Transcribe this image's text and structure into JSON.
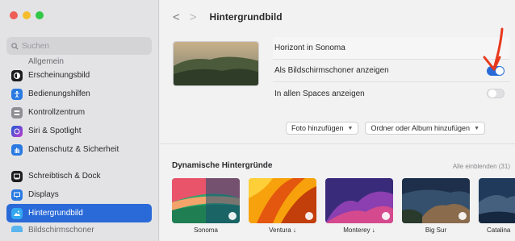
{
  "window": {
    "traffic_colors": [
      "#ee5e57",
      "#f5bd2e",
      "#33c748"
    ]
  },
  "sidebar": {
    "search_placeholder": "Suchen",
    "partial_top": "Allgemein",
    "items": [
      {
        "label": "Erscheinungsbild",
        "icon": "appearance-icon",
        "color": "#1d1d1f"
      },
      {
        "label": "Bedienungshilfen",
        "icon": "accessibility-icon",
        "color": "#2a7ae2"
      },
      {
        "label": "Kontrollzentrum",
        "icon": "control-center-icon",
        "color": "#8e8e93"
      },
      {
        "label": "Siri & Spotlight",
        "icon": "siri-icon",
        "color": "#7b4dd8"
      },
      {
        "label": "Datenschutz & Sicherheit",
        "icon": "privacy-hand-icon",
        "color": "#2a7ae2"
      },
      {
        "label": "Schreibtisch & Dock",
        "icon": "dock-icon",
        "color": "#1d1d1f"
      },
      {
        "label": "Displays",
        "icon": "displays-icon",
        "color": "#2a7ae2"
      },
      {
        "label": "Hintergrundbild",
        "icon": "wallpaper-icon",
        "color": "#33a7f0"
      },
      {
        "label": "Bildschirmschoner",
        "icon": "screensaver-icon",
        "color": "#5ab5ef"
      }
    ],
    "selected_index": 7
  },
  "header": {
    "back": "<",
    "forward": ">",
    "title": "Hintergrundbild"
  },
  "wallpaper": {
    "name": "Horizont in Sonoma",
    "screensaver_label": "Als Bildschirmschoner anzeigen",
    "screensaver_on": true,
    "spaces_label": "In allen Spaces anzeigen",
    "spaces_on": false
  },
  "actions": {
    "add_photo": "Foto hinzufügen",
    "add_folder": "Ordner oder Album hinzufügen"
  },
  "dynamic": {
    "heading": "Dynamische Hintergründe",
    "show_all": "Alle einblenden (31)",
    "items": [
      {
        "label": "Sonoma"
      },
      {
        "label": "Ventura ↓"
      },
      {
        "label": "Monterey ↓"
      },
      {
        "label": "Big Sur"
      },
      {
        "label": "Catalina"
      }
    ]
  },
  "annotation_color": "#e8391d"
}
